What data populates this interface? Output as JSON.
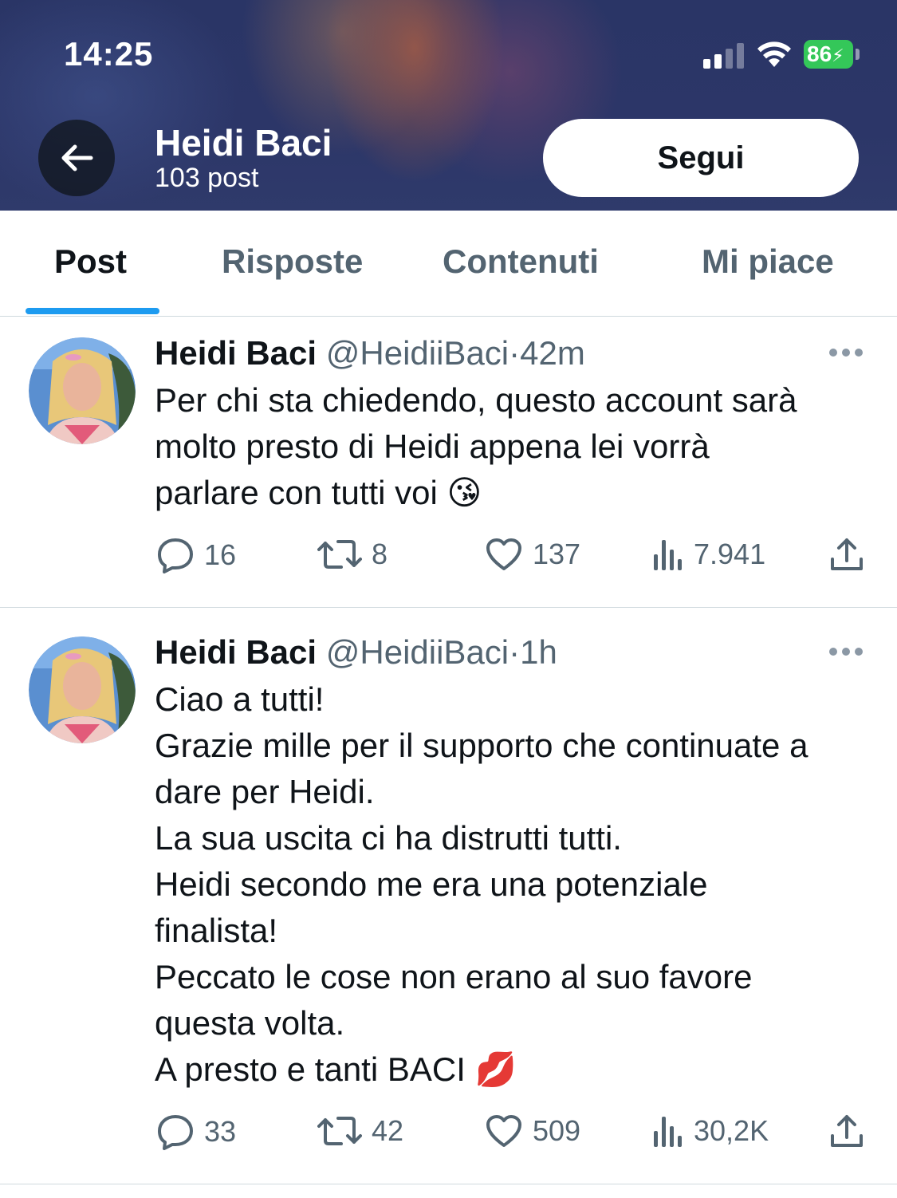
{
  "status_bar": {
    "time": "14:25",
    "battery": "86"
  },
  "header": {
    "name": "Heidi Baci",
    "post_count": "103 post",
    "follow_label": "Segui"
  },
  "tabs": [
    {
      "label": "Post",
      "active": true
    },
    {
      "label": "Risposte",
      "active": false
    },
    {
      "label": "Contenuti",
      "active": false
    },
    {
      "label": "Mi piace",
      "active": false
    }
  ],
  "tweets": [
    {
      "name": "Heidi Baci",
      "handle": "@HeidiiBaci",
      "separator": "·",
      "time": "42m",
      "lines": [
        "Per chi sta chiedendo, questo account sarà",
        "molto presto di Heidi appena lei vorrà",
        "parlare con tutti voi 😘"
      ],
      "replies": "16",
      "retweets": "8",
      "likes": "137",
      "views": "7.941"
    },
    {
      "name": "Heidi Baci",
      "handle": "@HeidiiBaci",
      "separator": "·",
      "time": "1h",
      "lines": [
        "Ciao a tutti!",
        "Grazie mille per il supporto che continuate a",
        "dare per Heidi.",
        "La sua uscita ci ha distrutti tutti.",
        "Heidi secondo me era una potenziale",
        "finalista!",
        "Peccato le cose non erano al suo favore",
        "questa volta.",
        "A presto e tanti BACI 💋"
      ],
      "replies": "33",
      "retweets": "42",
      "likes": "509",
      "views": "30,2K"
    }
  ],
  "colors": {
    "accent": "#1d9bf0",
    "text": "#0f1419",
    "secondary": "#536471",
    "battery": "#34c759"
  }
}
